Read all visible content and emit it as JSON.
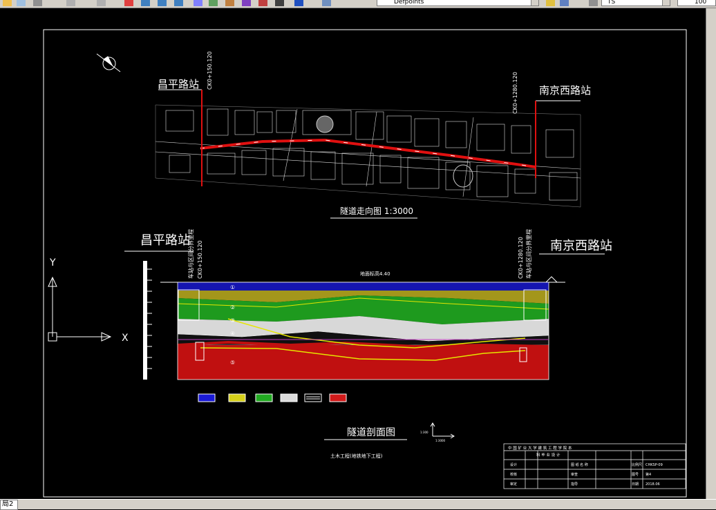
{
  "toolbar": {
    "layer_name": "Defpoints",
    "linetype": "TS",
    "zoom": "100"
  },
  "statusbar": {
    "tab": "局2"
  },
  "drawing": {
    "plan_station_left": "昌平路站",
    "plan_station_right": "南京西路站",
    "plan_chain_left": "CK0+150.120",
    "plan_chain_right": "CK0+1280.120",
    "plan_title": "隧道走向图  1:3000",
    "section_station_left": "昌平路站",
    "section_station_right": "南京西路站",
    "section_chain_left": "CK0+150.120",
    "section_chain_right": "CK0+1280.120",
    "section_vert_left": "车站与区间分界里程",
    "section_vert_right": "车站与区间分界里程",
    "ground_label": "地面标高4.40",
    "axis_y": "Y",
    "axis_x": "X",
    "layer_markers": [
      "①",
      "②",
      "③",
      "④",
      "⑤"
    ],
    "section_title": "隧道剖面图",
    "section_subtitle": "土木工程(地铁地下工程)",
    "legend_scale_v": "1:300",
    "legend_scale_h": "1:3000",
    "title_block": {
      "school": "中 国 矿 业 大 学 建 筑 工 程 学 院 本",
      "project": "科 毕 业 设 计",
      "row1": [
        "设计",
        "",
        "图 纸 名 称",
        "",
        "比例尺",
        "",
        "CHKSP-09"
      ],
      "row2": [
        "校核",
        "",
        "审查",
        "",
        "图号",
        "",
        "第4"
      ],
      "row3": [
        "审定",
        "",
        "指导",
        "",
        "日期",
        "",
        "2018.06"
      ],
      "row4": [
        "审批",
        "",
        "批准",
        "",
        "",
        "",
        ""
      ]
    }
  },
  "legend_colors": [
    "#1a1ad6",
    "#d6d01a",
    "#22aa22",
    "#dcdcdc",
    "#ffffff",
    "#d11a1a"
  ]
}
